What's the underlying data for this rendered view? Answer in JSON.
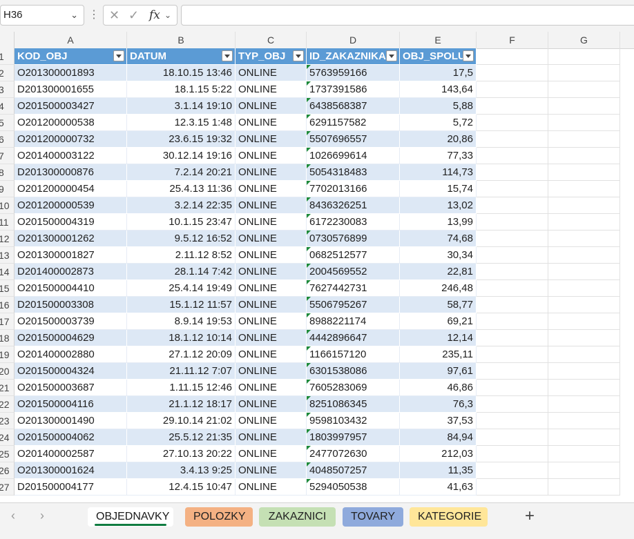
{
  "name_box": "H36",
  "formula_bar": {
    "x_icon": "cancel-icon",
    "check_icon": "enter-icon",
    "fx_label": "fx"
  },
  "columns": [
    "A",
    "B",
    "C",
    "D",
    "E",
    "F",
    "G"
  ],
  "table": {
    "headers": [
      "KOD_OBJ",
      "DATUM",
      "TYP_OBJ",
      "ID_ZAKAZNIKA",
      "OBJ_SPOLU"
    ],
    "rows": [
      [
        "O201300001893",
        "18.10.15 13:46",
        "ONLINE",
        "5763959166",
        "17,5"
      ],
      [
        "D201300001655",
        "18.1.15 5:22",
        "ONLINE",
        "1737391586",
        "143,64"
      ],
      [
        "O201500003427",
        "3.1.14 19:10",
        "ONLINE",
        "6438568387",
        "5,88"
      ],
      [
        "O201200000538",
        "12.3.15 1:48",
        "ONLINE",
        "6291157582",
        "5,72"
      ],
      [
        "O201200000732",
        "23.6.15 19:32",
        "ONLINE",
        "5507696557",
        "20,86"
      ],
      [
        "O201400003122",
        "30.12.14 19:16",
        "ONLINE",
        "1026699614",
        "77,33"
      ],
      [
        "D201300000876",
        "7.2.14 20:21",
        "ONLINE",
        "5054318483",
        "114,73"
      ],
      [
        "O201200000454",
        "25.4.13 11:36",
        "ONLINE",
        "7702013166",
        "15,74"
      ],
      [
        "O201200000539",
        "3.2.14 22:35",
        "ONLINE",
        "8436326251",
        "13,02"
      ],
      [
        "O201500004319",
        "10.1.15 23:47",
        "ONLINE",
        "6172230083",
        "13,99"
      ],
      [
        "O201300001262",
        "9.5.12 16:52",
        "ONLINE",
        "0730576899",
        "74,68"
      ],
      [
        "O201300001827",
        "2.11.12 8:52",
        "ONLINE",
        "0682512577",
        "30,34"
      ],
      [
        "D201400002873",
        "28.1.14 7:42",
        "ONLINE",
        "2004569552",
        "22,81"
      ],
      [
        "O201500004410",
        "25.4.14 19:49",
        "ONLINE",
        "7627442731",
        "246,48"
      ],
      [
        "D201500003308",
        "15.1.12 11:57",
        "ONLINE",
        "5506795267",
        "58,77"
      ],
      [
        "O201500003739",
        "8.9.14 19:53",
        "ONLINE",
        "8988221174",
        "69,21"
      ],
      [
        "O201500004629",
        "18.1.12 10:14",
        "ONLINE",
        "4442896647",
        "12,14"
      ],
      [
        "O201400002880",
        "27.1.12 20:09",
        "ONLINE",
        "1166157120",
        "235,11"
      ],
      [
        "O201500004324",
        "21.11.12 7:07",
        "ONLINE",
        "6301538086",
        "97,61"
      ],
      [
        "O201500003687",
        "1.11.15 12:46",
        "ONLINE",
        "7605283069",
        "46,86"
      ],
      [
        "O201500004116",
        "21.1.12 18:17",
        "ONLINE",
        "8251086345",
        "76,3"
      ],
      [
        "O201300001490",
        "29.10.14 21:02",
        "ONLINE",
        "9598103432",
        "37,53"
      ],
      [
        "O201500004062",
        "25.5.12 21:35",
        "ONLINE",
        "1803997957",
        "84,94"
      ],
      [
        "O201400002587",
        "27.10.13 20:22",
        "ONLINE",
        "2477072630",
        "212,03"
      ],
      [
        "O201300001624",
        "3.4.13 9:25",
        "ONLINE",
        "4048507257",
        "11,35"
      ],
      [
        "D201500004177",
        "12.4.15 10:47",
        "ONLINE",
        "5294050538",
        "41,63"
      ]
    ]
  },
  "row_numbers": [
    "1",
    "2",
    "3",
    "4",
    "5",
    "6",
    "7",
    "8",
    "9",
    "10",
    "11",
    "12",
    "13",
    "14",
    "15",
    "16",
    "17",
    "18",
    "19",
    "20",
    "21",
    "22",
    "23",
    "24",
    "25",
    "26",
    "27"
  ],
  "sheets": [
    {
      "label": "OBJEDNAVKY",
      "color": "#ffffff",
      "active": true
    },
    {
      "label": "POLOZKY",
      "color": "#f4b183",
      "active": false
    },
    {
      "label": "ZAKAZNICI",
      "color": "#c5e0b4",
      "active": false
    },
    {
      "label": "TOVARY",
      "color": "#8faadc",
      "active": false
    },
    {
      "label": "KATEGORIE",
      "color": "#ffe699",
      "active": false
    }
  ],
  "add_sheet_label": "+",
  "colors": {
    "header_fill": "#5b9bd5",
    "band_fill": "#dde8f5",
    "accent_green": "#107c41"
  }
}
